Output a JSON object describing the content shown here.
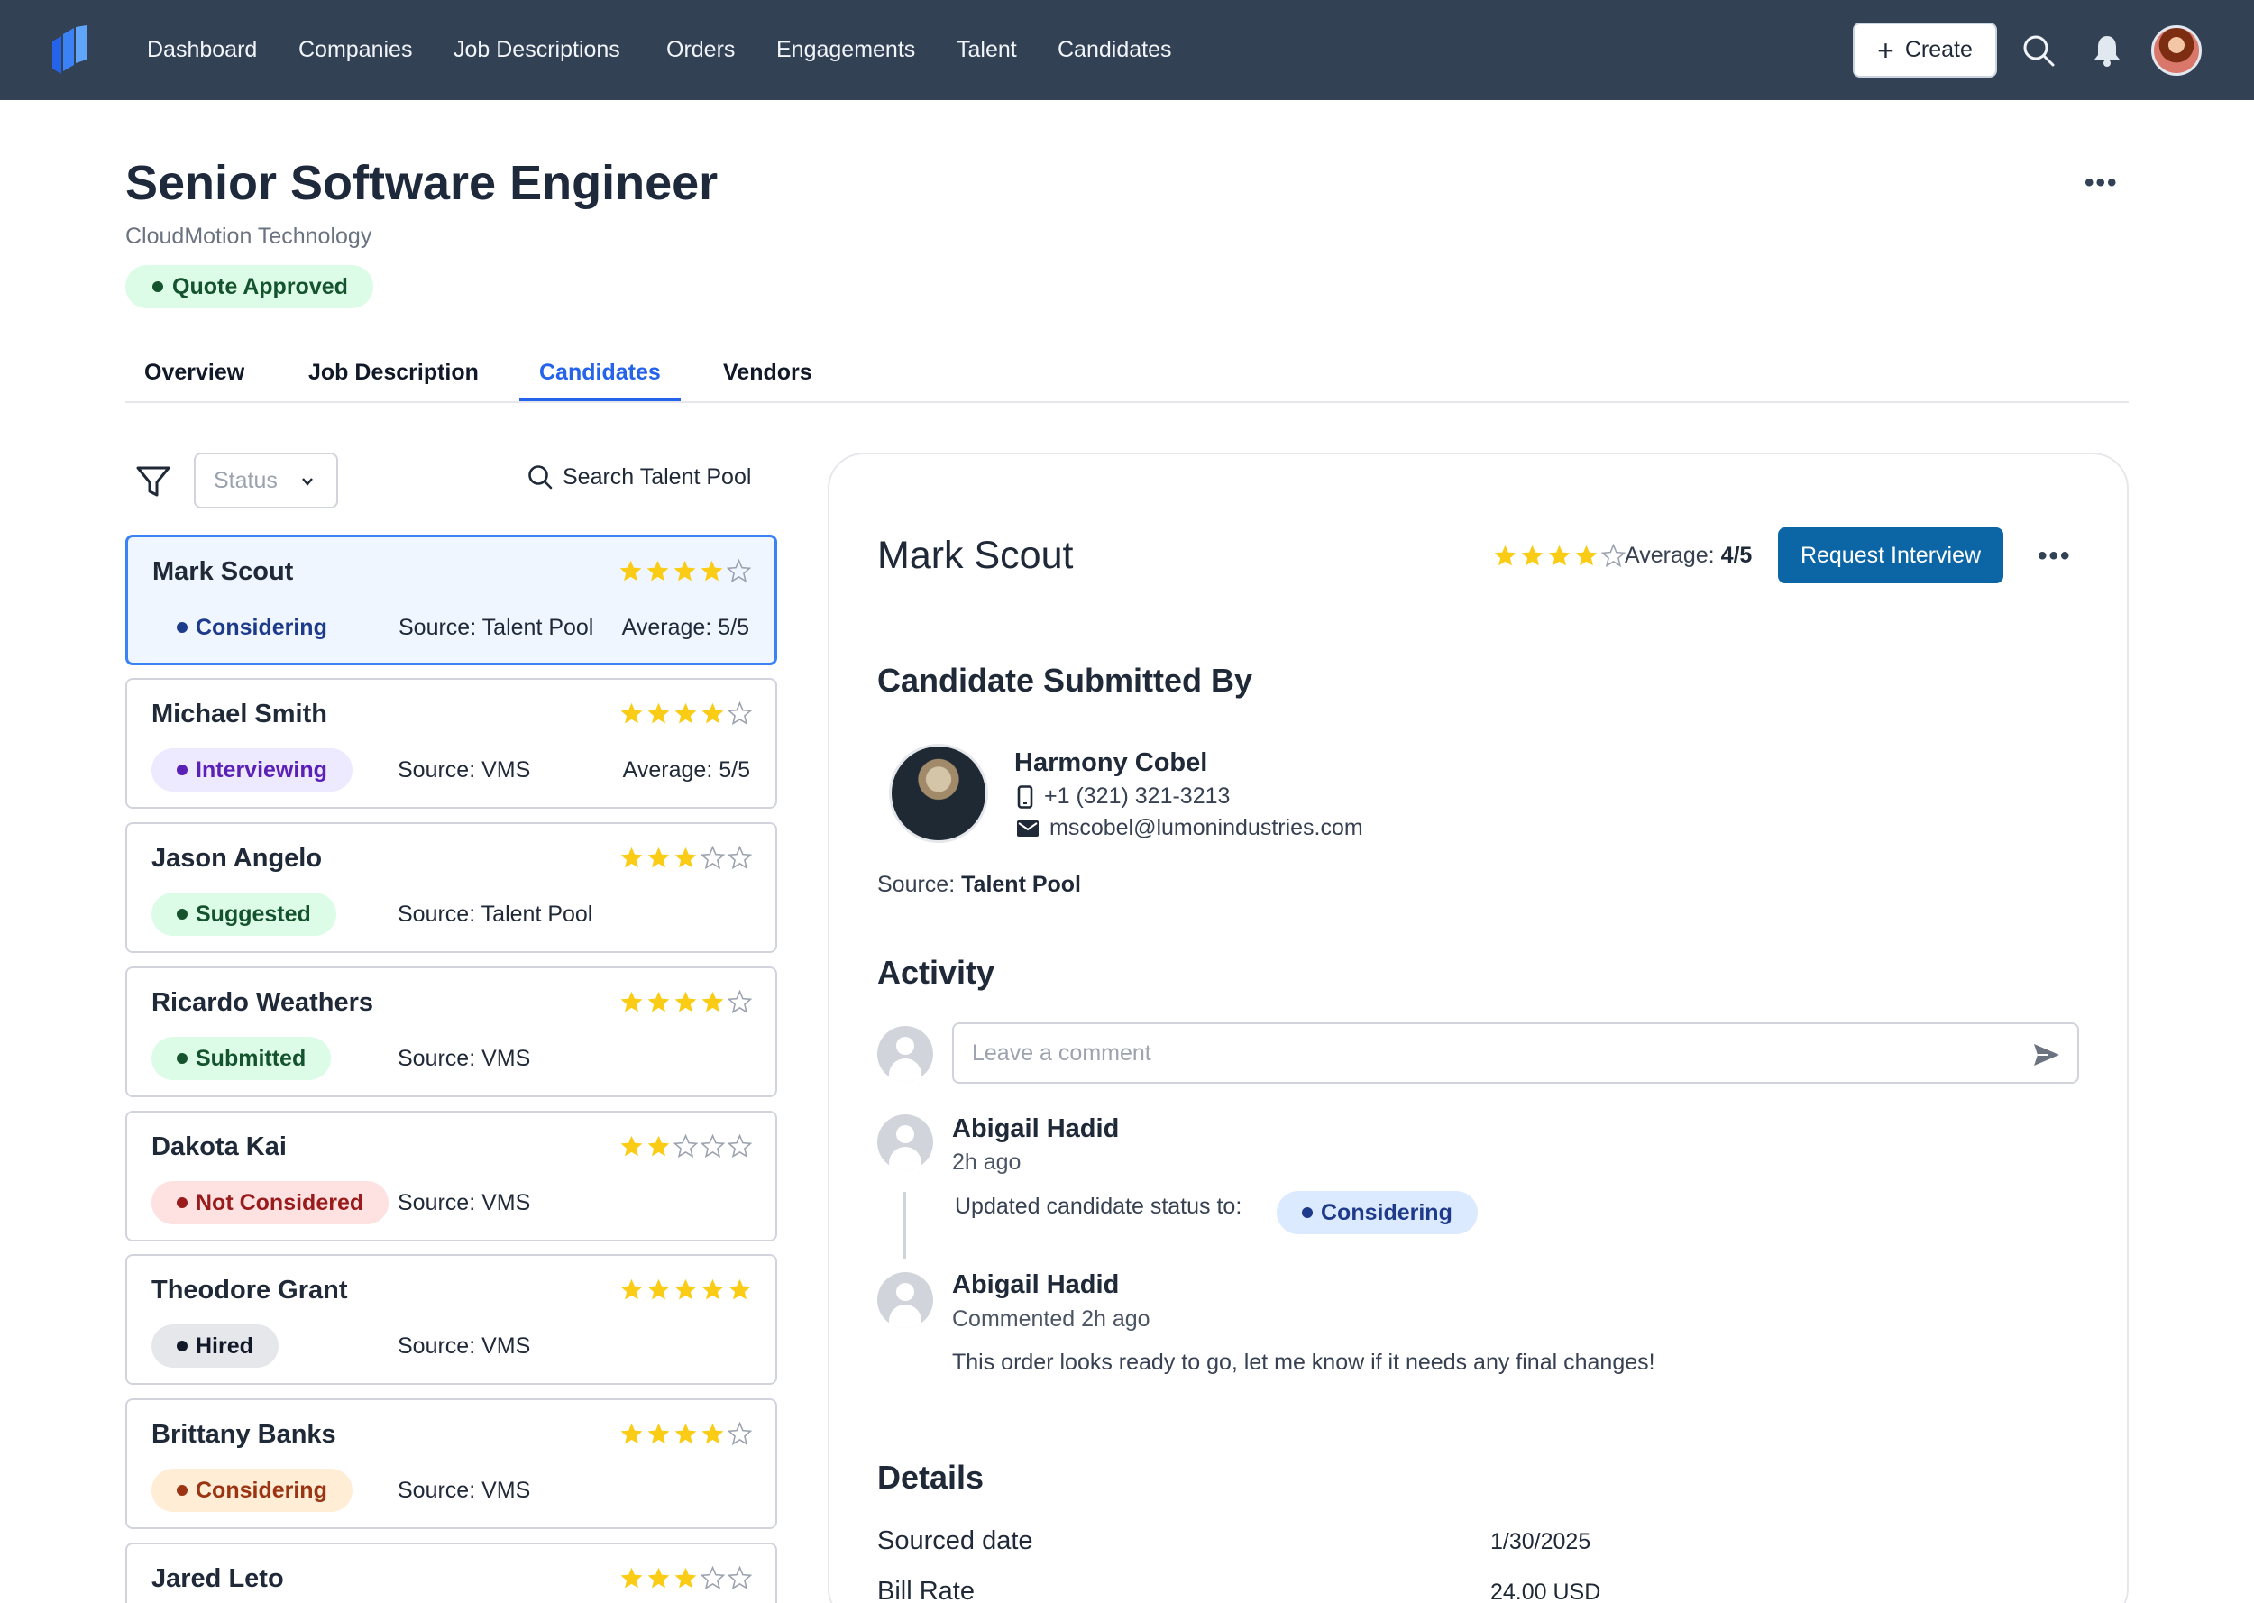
{
  "nav": {
    "items": [
      "Dashboard",
      "Companies",
      "Job Descriptions",
      "Orders",
      "Engagements",
      "Talent",
      "Candidates"
    ],
    "create_label": "Create"
  },
  "header": {
    "title": "Senior Software Engineer",
    "company": "CloudMotion Technology",
    "status": "Quote Approved"
  },
  "tabs": [
    "Overview",
    "Job Description",
    "Candidates",
    "Vendors"
  ],
  "active_tab": "Candidates",
  "filters": {
    "status_placeholder": "Status",
    "search_label": "Search Talent Pool"
  },
  "candidates": [
    {
      "name": "Mark Scout",
      "rating": 4,
      "status": "Considering",
      "source_label": "Source:",
      "source": "Talent Pool",
      "avg_label": "Average:",
      "average": "5/5"
    },
    {
      "name": "Michael Smith",
      "rating": 4,
      "status": "Interviewing",
      "source_label": "Source:",
      "source": "VMS",
      "avg_label": "Average:",
      "average": "5/5"
    },
    {
      "name": "Jason Angelo",
      "rating": 3,
      "status": "Suggested",
      "source_label": "Source:",
      "source": "Talent Pool",
      "avg_label": "",
      "average": ""
    },
    {
      "name": "Ricardo Weathers",
      "rating": 4,
      "status": "Submitted",
      "source_label": "Source:",
      "source": "VMS",
      "avg_label": "",
      "average": ""
    },
    {
      "name": "Dakota Kai",
      "rating": 2,
      "status": "Not Considered",
      "source_label": "Source:",
      "source": "VMS",
      "avg_label": "",
      "average": ""
    },
    {
      "name": "Theodore Grant",
      "rating": 5,
      "status": "Hired",
      "source_label": "Source:",
      "source": "VMS",
      "avg_label": "",
      "average": ""
    },
    {
      "name": "Brittany Banks",
      "rating": 4,
      "status": "Considering",
      "source_label": "Source:",
      "source": "VMS",
      "avg_label": "",
      "average": ""
    },
    {
      "name": "Jared Leto",
      "rating": 3,
      "status": "",
      "source_label": "",
      "source": "",
      "avg_label": "",
      "average": ""
    }
  ],
  "detail": {
    "name": "Mark Scout",
    "rating": 4,
    "avg_label": "Average:",
    "average": "4/5",
    "request_label": "Request Interview",
    "submitted_heading": "Candidate Submitted By",
    "submitter": {
      "name": "Harmony Cobel",
      "phone": "+1 (321) 321-3213",
      "email": "mscobel@lumonindustries.com"
    },
    "source_label": "Source:",
    "source": "Talent Pool",
    "activity_heading": "Activity",
    "comment_placeholder": "Leave a comment",
    "activity": [
      {
        "name": "Abigail Hadid",
        "time": "2h ago",
        "text": "Updated candidate status to:",
        "badge": "Considering"
      },
      {
        "name": "Abigail Hadid",
        "time": "Commented 2h ago",
        "text": "This order looks ready to go, let me know if it needs any final changes!"
      }
    ],
    "details_heading": "Details",
    "details": [
      {
        "label": "Sourced date",
        "value": "1/30/2025"
      },
      {
        "label": "Bill Rate",
        "value": "24.00 USD"
      }
    ]
  },
  "colors": {
    "nav_bg": "#334155",
    "accent": "#2563eb",
    "primary_button": "#0c66a6",
    "star": "#facc15"
  }
}
